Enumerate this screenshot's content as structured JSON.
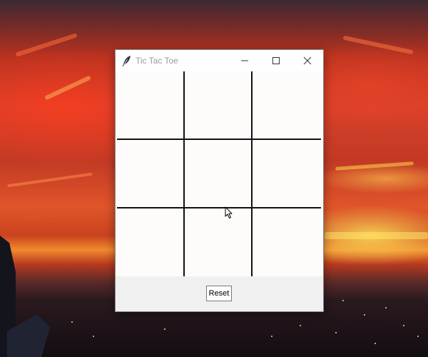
{
  "window": {
    "title": "Tic Tac Toe",
    "app_icon": "feather-icon",
    "controls": {
      "minimize": "minimize-icon",
      "maximize": "maximize-icon",
      "close": "close-icon"
    }
  },
  "board": {
    "rows": 3,
    "cols": 3,
    "cells": [
      [
        "",
        "",
        ""
      ],
      [
        "",
        "",
        ""
      ],
      [
        "",
        "",
        ""
      ]
    ],
    "line_color": "#111111",
    "background": "#fdfcfb"
  },
  "actions": {
    "reset_label": "Reset"
  },
  "colors": {
    "titlebar_bg": "#ffffff",
    "window_bg": "#f0f0f0",
    "title_text": "#9a9a9a"
  }
}
